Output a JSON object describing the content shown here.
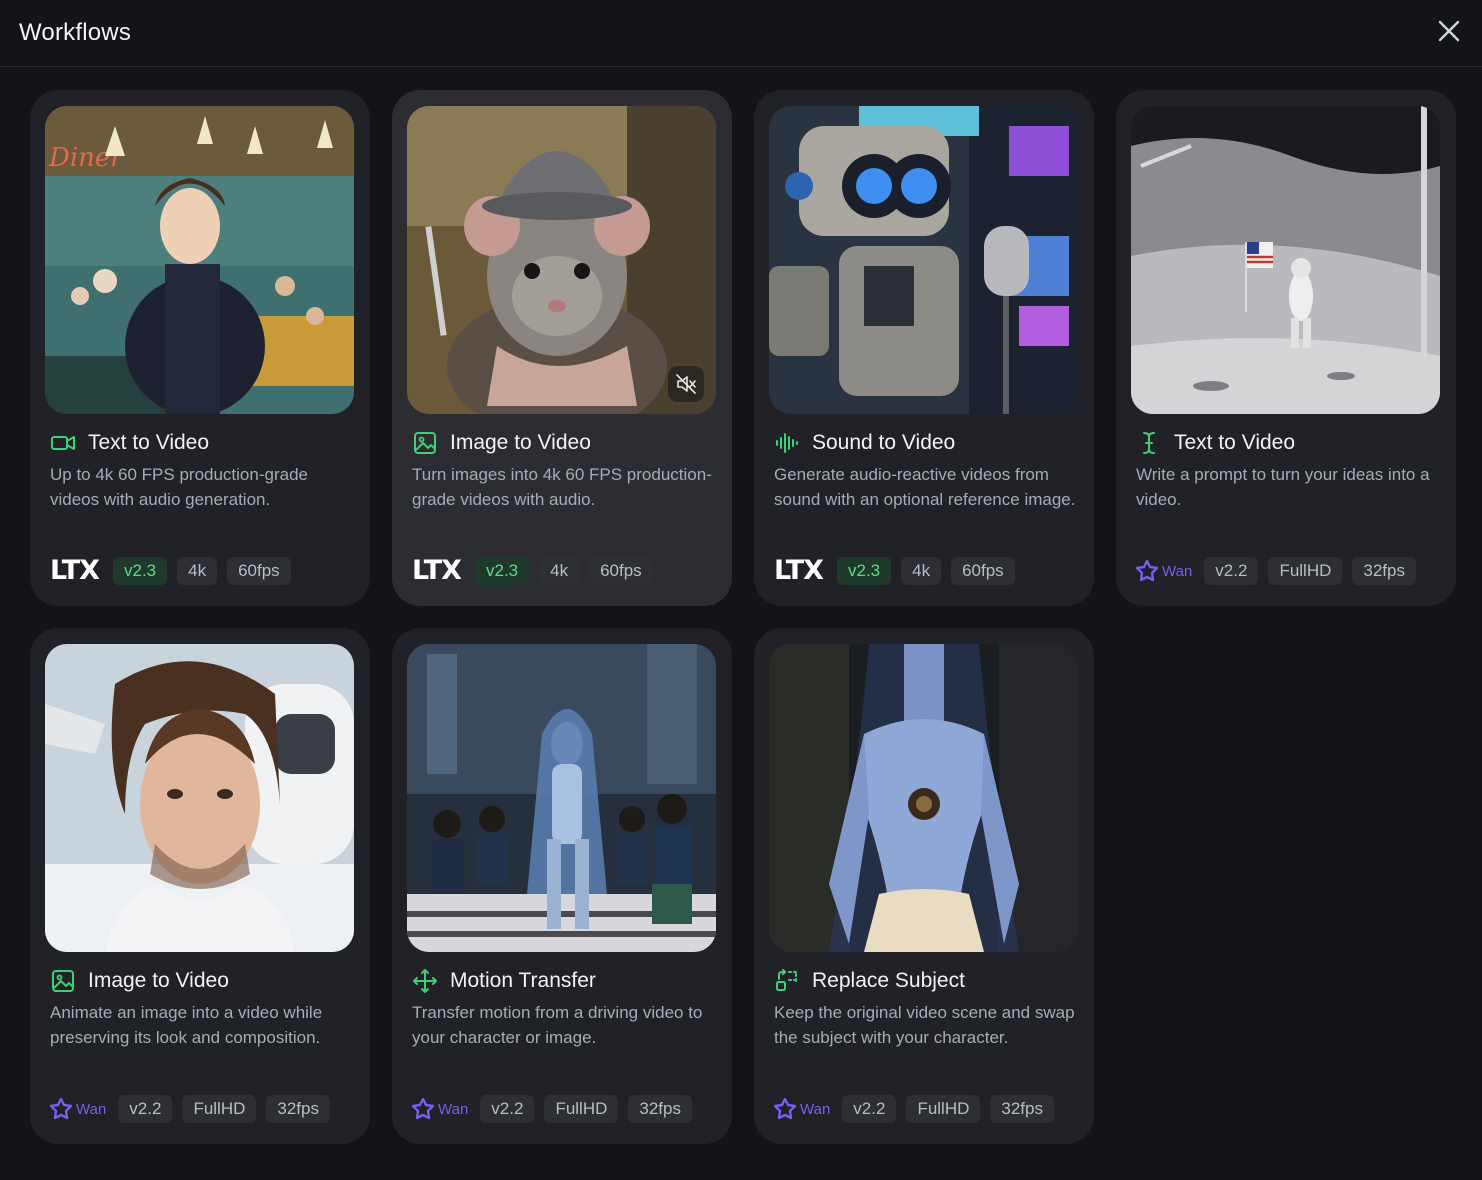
{
  "header": {
    "title": "Workflows",
    "close_icon": "close-icon"
  },
  "colors": {
    "accent_green": "#3fcf74",
    "wan_purple": "#7b5cf0",
    "card_bg": "#202227"
  },
  "cards": [
    {
      "icon": "video-camera-icon",
      "title": "Text to Video",
      "description": "Up to 4k 60 FPS production-grade videos with audio generation.",
      "brand": "ltx",
      "version": "v2.3",
      "tags": [
        "4k",
        "60fps"
      ]
    },
    {
      "icon": "image-icon",
      "title": "Image to Video",
      "description": "Turn images into 4k 60 FPS production-grade videos with audio.",
      "brand": "ltx",
      "version": "v2.3",
      "tags": [
        "4k",
        "60fps"
      ],
      "muted_icon": "volume-mute-icon"
    },
    {
      "icon": "audio-waveform-icon",
      "title": "Sound to Video",
      "description": "Generate audio-reactive videos from sound with an optional reference image.",
      "brand": "ltx",
      "version": "v2.3",
      "tags": [
        "4k",
        "60fps"
      ]
    },
    {
      "icon": "text-cursor-icon",
      "title": "Text to Video",
      "description": "Write a prompt to turn your ideas into a video.",
      "brand": "Wan",
      "version": "v2.2",
      "tags": [
        "FullHD",
        "32fps"
      ]
    },
    {
      "icon": "image-icon",
      "title": "Image to Video",
      "description": "Animate an image into a video while preserving its look and composition.",
      "brand": "Wan",
      "version": "v2.2",
      "tags": [
        "FullHD",
        "32fps"
      ]
    },
    {
      "icon": "move-arrows-icon",
      "title": "Motion Transfer",
      "description": "Transfer motion from a driving video to your character or image.",
      "brand": "Wan",
      "version": "v2.2",
      "tags": [
        "FullHD",
        "32fps"
      ]
    },
    {
      "icon": "replace-icon",
      "title": "Replace Subject",
      "description": "Keep the original video scene and swap the subject with your character.",
      "brand": "Wan",
      "version": "v2.2",
      "tags": [
        "FullHD",
        "32fps"
      ]
    }
  ]
}
